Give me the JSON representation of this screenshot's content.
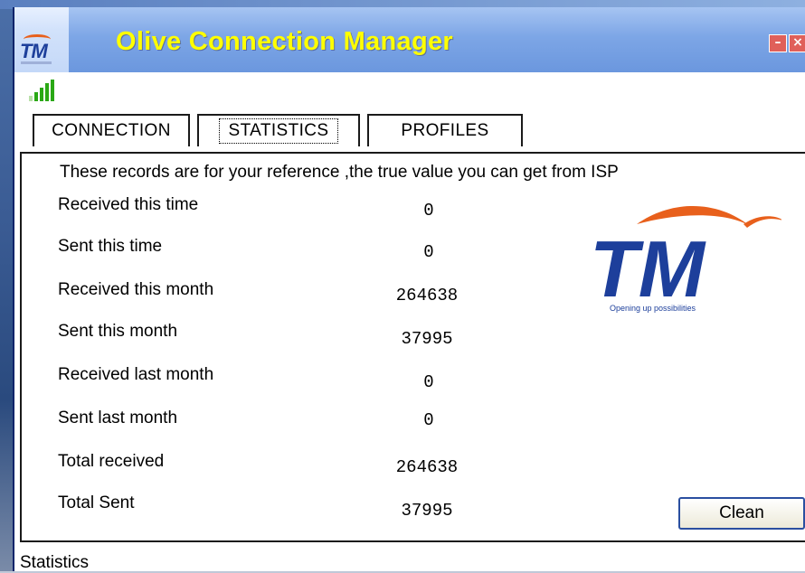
{
  "window": {
    "title": "Olive Connection Manager",
    "logo_text": "TM",
    "minimize_glyph": "–",
    "close_glyph": "×"
  },
  "tabs": [
    {
      "label": "CONNECTION",
      "active": false
    },
    {
      "label": "STATISTICS",
      "active": true
    },
    {
      "label": "PROFILES",
      "active": false
    }
  ],
  "statistics": {
    "note": "These records are for your reference ,the true value you can get from ISP",
    "rows": [
      {
        "label": "Received this time",
        "value": "0"
      },
      {
        "label": "Sent this time",
        "value": "0"
      },
      {
        "label": "Received this month",
        "value": "264638"
      },
      {
        "label": "Sent this month",
        "value": "37995"
      },
      {
        "label": "Received last month",
        "value": "0"
      },
      {
        "label": "Sent last month",
        "value": "0"
      },
      {
        "label": "Total received",
        "value": "264638"
      },
      {
        "label": "Total Sent",
        "value": "37995"
      }
    ],
    "clean_label": "Clean"
  },
  "brand_logo": {
    "text": "TM",
    "tagline": "Opening up possibilities",
    "blue": "#1d3f9b",
    "orange": "#e8601c"
  },
  "status_bar": {
    "text": "Statistics"
  },
  "colors": {
    "title_text": "#ffff00",
    "signal": "#2aa815"
  }
}
